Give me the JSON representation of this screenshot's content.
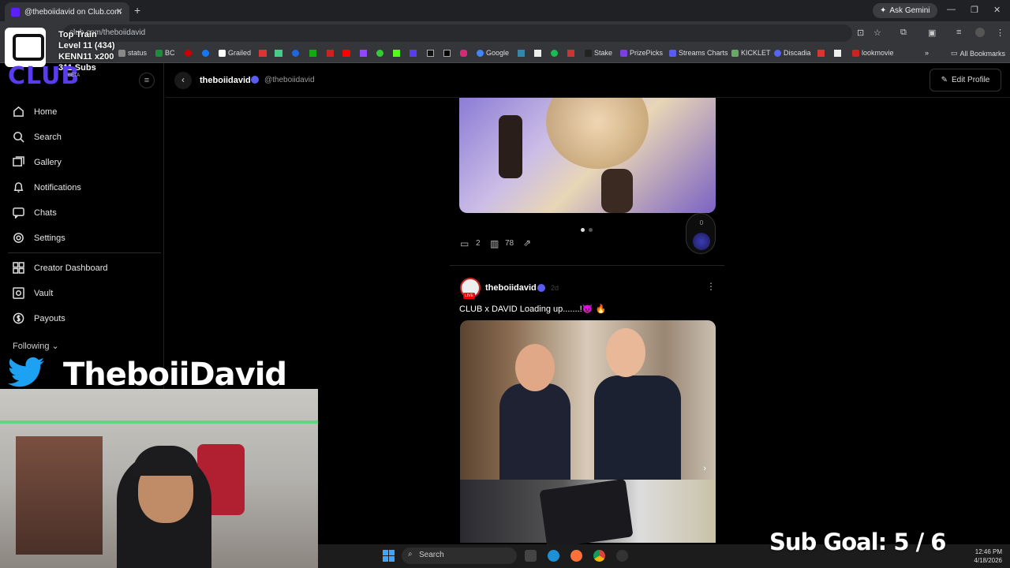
{
  "browser": {
    "tab_title": "@theboiidavid on Club.com",
    "ask_gemini": "Ask Gemini",
    "url": "club.com/theboiidavid",
    "all_bookmarks": "All Bookmarks",
    "bookmarks": [
      "status",
      "BC",
      "Grailed",
      "Google",
      "Stake",
      "PrizePicks",
      "Streams Charts",
      "KICKLET",
      "Discadia",
      "lookmovie"
    ]
  },
  "stream_overlay": {
    "train_title": "Top Train",
    "train_level": "Level 11  (434)",
    "train_user": "KENN11 x200",
    "train_subs": "311 Subs",
    "logo": "CLUB",
    "beta": "BETA",
    "streamer_name": "TheboiiDavid",
    "sub_goal": "Sub Goal:  5 / 6"
  },
  "sidebar": {
    "items": [
      {
        "label": "Home",
        "icon": "home-icon"
      },
      {
        "label": "Search",
        "icon": "search-icon"
      },
      {
        "label": "Gallery",
        "icon": "gallery-icon"
      },
      {
        "label": "Notifications",
        "icon": "bell-icon"
      },
      {
        "label": "Chats",
        "icon": "chat-icon"
      },
      {
        "label": "Settings",
        "icon": "gear-icon"
      },
      {
        "label": "Creator Dashboard",
        "icon": "dashboard-icon"
      },
      {
        "label": "Vault",
        "icon": "vault-icon"
      },
      {
        "label": "Payouts",
        "icon": "dollar-icon"
      }
    ],
    "following_label": "Following"
  },
  "header": {
    "name": "theboiidavid",
    "handle": "@theboiidavid",
    "edit_profile": "Edit Profile"
  },
  "post1": {
    "comments": "2",
    "views": "78",
    "fab_count": "0"
  },
  "post2": {
    "author": "theboiidavid",
    "time": "2d",
    "live_badge": "LIVE",
    "text": "CLUB x DAVID Loading up.......!😈 🔥"
  },
  "taskbar": {
    "search": "Search",
    "time": "12:46 PM",
    "date": "4/18/2026"
  },
  "colors": {
    "accent": "#5a3cf0",
    "verified": "#5a5cf0",
    "live": "#e00000"
  }
}
